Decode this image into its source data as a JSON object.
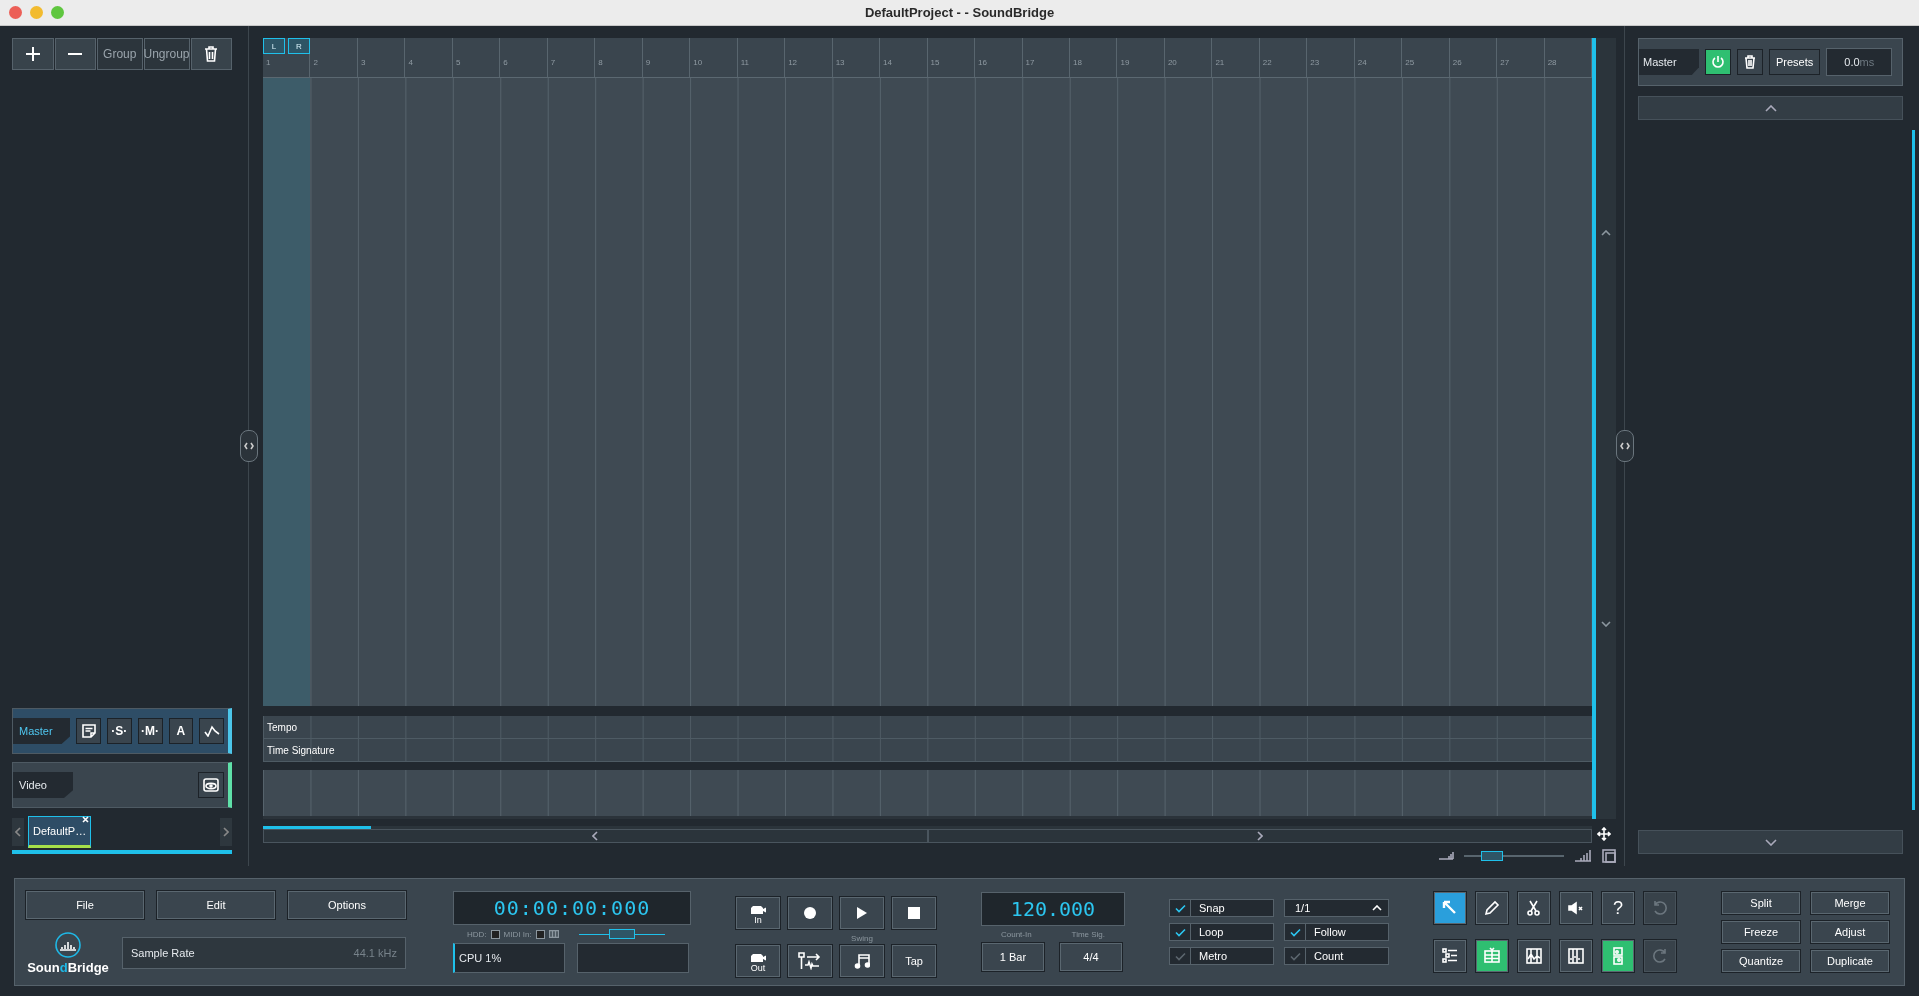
{
  "window": {
    "title": "DefaultProject -  - SoundBridge"
  },
  "track_toolbar": {
    "group": "Group",
    "ungroup": "Ungroup"
  },
  "ruler": {
    "bars": [
      "1",
      "2",
      "3",
      "4",
      "5",
      "6",
      "7",
      "8",
      "9",
      "10",
      "11",
      "12",
      "13",
      "14",
      "15",
      "16",
      "17",
      "18",
      "19",
      "20",
      "21",
      "22",
      "23",
      "24",
      "25",
      "26",
      "27",
      "28"
    ],
    "loop_left": "L",
    "loop_right": "R"
  },
  "master_track": {
    "name": "Master",
    "buttons": [
      "·S·",
      "·M·",
      "A"
    ]
  },
  "video_track": {
    "name": "Video"
  },
  "project_tabs": [
    {
      "label": "DefaultP…",
      "selected": true
    }
  ],
  "global_lanes": [
    "Tempo",
    "Time Signature"
  ],
  "zoom": {
    "level": 0.22
  },
  "right_panel": {
    "channel": "Master",
    "power_on": true,
    "presets": "Presets",
    "delay": "0.0",
    "delay_unit": "ms"
  },
  "menu": [
    "File",
    "Edit",
    "Options"
  ],
  "logo": [
    {
      "text": "Soun",
      "color": "#ffffff"
    },
    {
      "text": "d",
      "color": "#1fb8e6"
    },
    {
      "text": "Bridge",
      "color": "#ffffff"
    }
  ],
  "sample_rate": {
    "label": "Sample Rate",
    "value": "44.1 kHz"
  },
  "time_display": "00:00:00:000",
  "meters": {
    "hdd": "HDD:",
    "midi": "MIDI In:",
    "volume": {
      "level": 0.5
    },
    "cpu": "CPU 1%"
  },
  "transport": {
    "record_in": "In",
    "record_out": "Out",
    "swing": "Swing",
    "tap": "Tap"
  },
  "tempo": {
    "value": "120.000",
    "count_in_label": "Count-In",
    "count_in": "1 Bar",
    "time_sig_label": "Time Sig.",
    "time_sig": "4/4"
  },
  "options": [
    {
      "label": "Snap",
      "checked": true
    },
    {
      "label": "Loop",
      "checked": true
    },
    {
      "label": "Metro",
      "checked": false
    }
  ],
  "options_2": [
    {
      "label": "Follow",
      "checked": true
    },
    {
      "label": "Count",
      "checked": false
    }
  ],
  "grid_value": "1/1",
  "tools": [
    {
      "kind": "pointer",
      "selected": true
    },
    {
      "kind": "pencil",
      "selected": false
    },
    {
      "kind": "scissors",
      "selected": false
    },
    {
      "kind": "mute",
      "selected": false
    },
    {
      "kind": "help",
      "label": "?",
      "selected": false
    }
  ],
  "views": [
    {
      "kind": "tracklist",
      "on": false
    },
    {
      "kind": "arranger",
      "on": true
    },
    {
      "kind": "automation",
      "on": false
    },
    {
      "kind": "mixer",
      "on": false
    },
    {
      "kind": "split",
      "on": true
    }
  ],
  "history": [
    {
      "kind": "undo",
      "disabled": true
    },
    {
      "kind": "redo",
      "disabled": true
    }
  ],
  "edit_buttons": [
    "Split",
    "Merge",
    "Freeze",
    "Adjust",
    "Quantize",
    "Duplicate"
  ]
}
